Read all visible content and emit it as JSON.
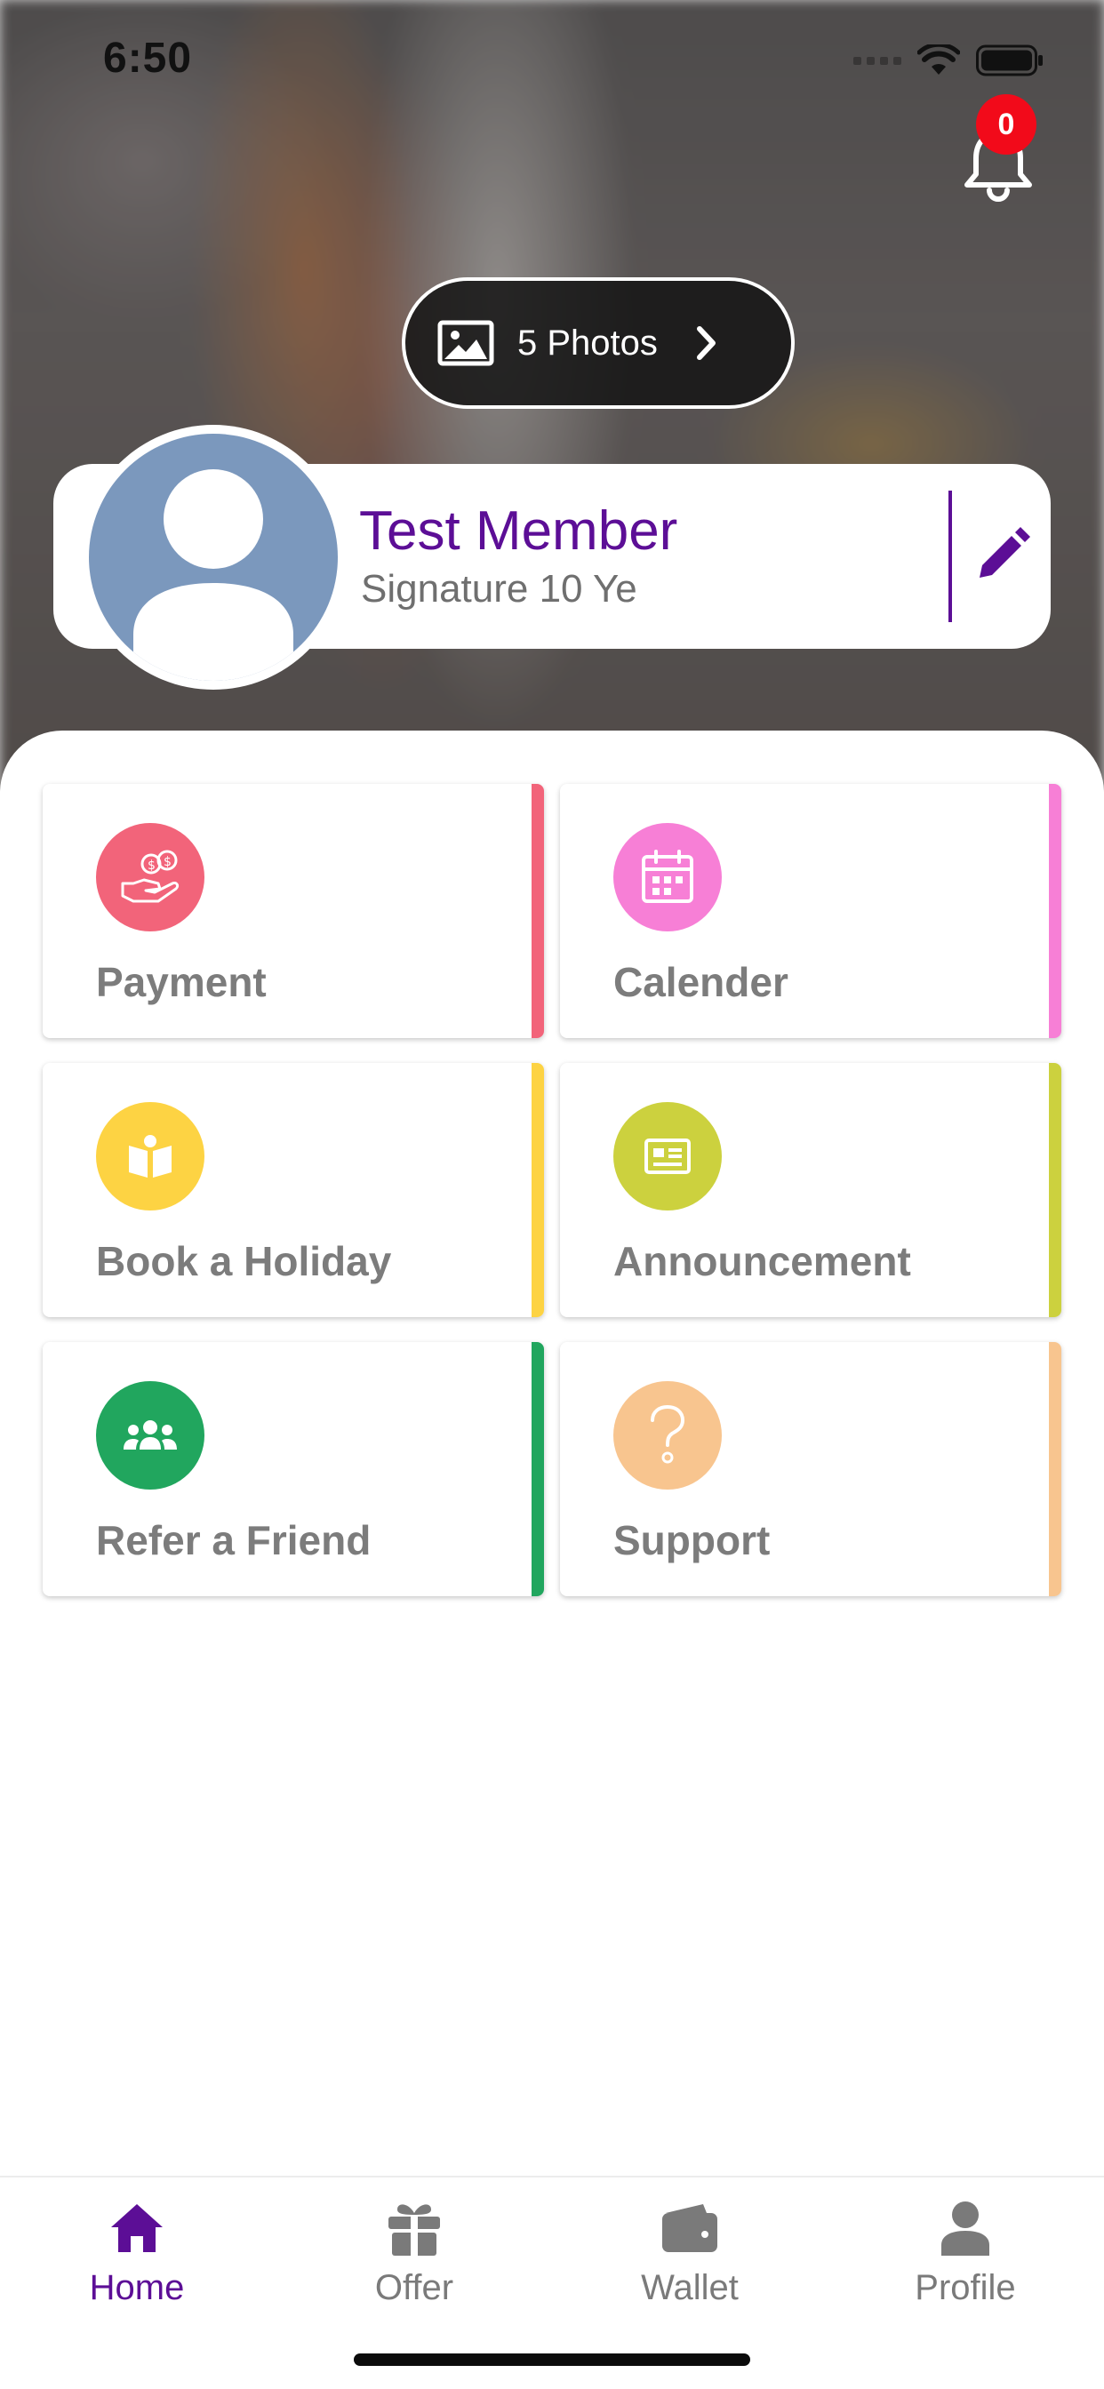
{
  "status_bar": {
    "time": "6:50"
  },
  "notifications": {
    "count": "0"
  },
  "photos": {
    "label": "5 Photos"
  },
  "profile": {
    "name": "Test Member",
    "subtitle": "Signature 10 Ye"
  },
  "tiles": [
    {
      "label": "Payment",
      "icon": "payment-icon",
      "color": "#f2647a",
      "accent": "#f2647a"
    },
    {
      "label": "Calender",
      "icon": "calendar-icon",
      "color": "#f77fd6",
      "accent": "#f77fd6"
    },
    {
      "label": "Book a Holiday",
      "icon": "book-icon",
      "color": "#fdd343",
      "accent": "#fdd343"
    },
    {
      "label": "Announcement",
      "icon": "newspaper-icon",
      "color": "#ccd13e",
      "accent": "#ccd13e"
    },
    {
      "label": "Refer a Friend",
      "icon": "group-icon",
      "color": "#21a65e",
      "accent": "#21a65e"
    },
    {
      "label": "Support",
      "icon": "question-icon",
      "color": "#f8c58f",
      "accent": "#f8c58f"
    }
  ],
  "bottom_nav": [
    {
      "label": "Home",
      "icon": "home-icon",
      "active": true
    },
    {
      "label": "Offer",
      "icon": "gift-icon",
      "active": false
    },
    {
      "label": "Wallet",
      "icon": "wallet-icon",
      "active": false
    },
    {
      "label": "Profile",
      "icon": "person-icon",
      "active": false
    }
  ],
  "colors": {
    "brand": "#5c0e96",
    "badge": "#f20a1a",
    "nav_inactive": "#7a7a7a",
    "avatar_bg": "#7b98bd"
  }
}
